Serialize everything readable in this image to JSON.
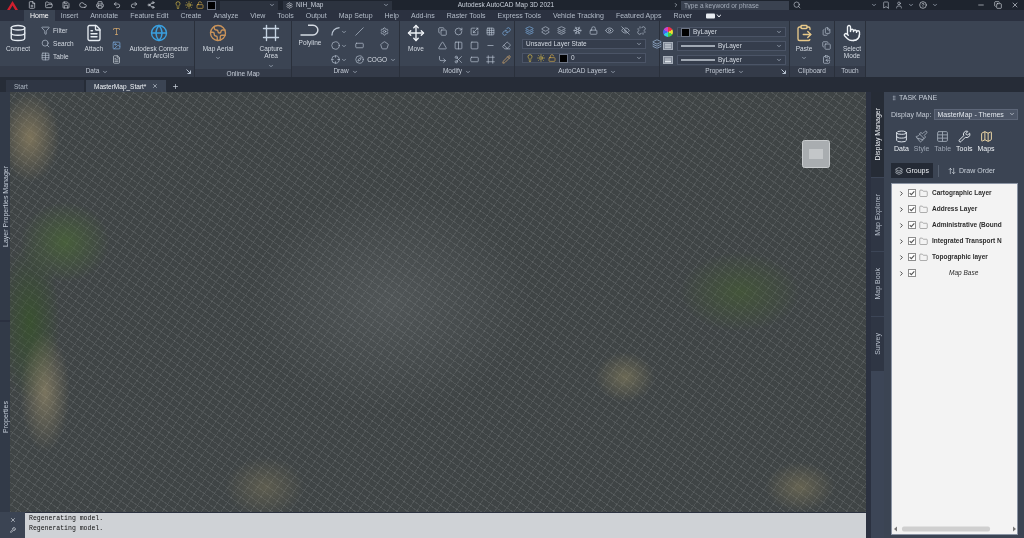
{
  "title_bar": {
    "workspace": "NIH_Map",
    "title": "Autodesk AutoCAD Map 3D 2021",
    "search": {
      "placeholder": "Type a keyword or phrase"
    }
  },
  "ribbon_tabs": [
    {
      "label": "Home",
      "selected": true
    },
    {
      "label": "Insert",
      "selected": false
    },
    {
      "label": "Annotate",
      "selected": false
    },
    {
      "label": "Feature Edit",
      "selected": false
    },
    {
      "label": "Create",
      "selected": false
    },
    {
      "label": "Analyze",
      "selected": false
    },
    {
      "label": "View",
      "selected": false
    },
    {
      "label": "Tools",
      "selected": false
    },
    {
      "label": "Output",
      "selected": false
    },
    {
      "label": "Map Setup",
      "selected": false
    },
    {
      "label": "Help",
      "selected": false
    },
    {
      "label": "Add-ins",
      "selected": false
    },
    {
      "label": "Raster Tools",
      "selected": false
    },
    {
      "label": "Express Tools",
      "selected": false
    },
    {
      "label": "Vehicle Tracking",
      "selected": false
    },
    {
      "label": "Featured Apps",
      "selected": false
    },
    {
      "label": "Rover",
      "selected": false
    }
  ],
  "ribbon_panels": [
    {
      "title": "Data",
      "menu": true,
      "launcher": true,
      "tools": [
        {
          "kind": "large",
          "label": "Connect",
          "dropdown": false
        },
        {
          "kind": "stack",
          "items": [
            "Filter",
            "Search",
            "Table"
          ]
        },
        {
          "kind": "large",
          "label": "Attach",
          "dropdown": false
        },
        {
          "kind": "icons"
        },
        {
          "kind": "large",
          "label": "Autodesk Connector for ArcGIS",
          "dropdown": false
        }
      ]
    },
    {
      "title": "Online Map",
      "menu": false,
      "launcher": false,
      "tools": [
        {
          "kind": "large",
          "label": "Map Aerial",
          "dropdown": true
        },
        {
          "kind": "large",
          "label": "Capture Area",
          "dropdown": true
        }
      ]
    },
    {
      "title": "Draw",
      "menu": true,
      "launcher": false,
      "tools": [
        {
          "kind": "large",
          "label": "Polyline",
          "dropdown": false
        },
        {
          "kind": "draw_grid",
          "label": "COGO"
        }
      ]
    },
    {
      "title": "Modify",
      "menu": true,
      "launcher": false,
      "tools": [
        {
          "kind": "large",
          "label": "Move",
          "dropdown": false
        },
        {
          "kind": "icons"
        }
      ]
    },
    {
      "title": "AutoCAD Layers",
      "menu": true,
      "launcher": false,
      "tools": [
        {
          "kind": "layers",
          "layer_state": "Unsaved Layer State",
          "current_layer": "0"
        }
      ]
    },
    {
      "title": "Properties",
      "menu": true,
      "launcher": true,
      "tools": [
        {
          "kind": "properties",
          "values": [
            "ByLayer",
            "ByLayer",
            "ByLayer"
          ]
        }
      ]
    },
    {
      "title": "Clipboard",
      "menu": false,
      "launcher": false,
      "tools": [
        {
          "kind": "large",
          "label": "Paste",
          "dropdown": true
        },
        {
          "kind": "icons"
        }
      ]
    },
    {
      "title": "Touch",
      "menu": false,
      "launcher": false,
      "tools": [
        {
          "kind": "large",
          "label": "Select Mode",
          "dropdown": false
        }
      ]
    }
  ],
  "file_tabs": [
    {
      "label": "Start",
      "selected": false,
      "closable": false
    },
    {
      "label": "MasterMap_Start*",
      "selected": true,
      "closable": true
    }
  ],
  "left_tabs": [
    "Layer Properties Manager",
    "Properties"
  ],
  "command_line": {
    "history": [
      "Regenerating model.",
      "Regenerating model."
    ]
  },
  "task_pane": {
    "title": "TASK PANE",
    "side_tabs": [
      {
        "label": "Display Manager",
        "selected": true
      },
      {
        "label": "Map Explorer",
        "selected": false
      },
      {
        "label": "Map Book",
        "selected": false
      },
      {
        "label": "Survey",
        "selected": false
      }
    ],
    "display_map": {
      "label": "Display Map:",
      "value": "MasterMap - Themes"
    },
    "tools": [
      {
        "label": "Data",
        "disabled": false
      },
      {
        "label": "Style",
        "disabled": true
      },
      {
        "label": "Table",
        "disabled": true
      },
      {
        "label": "Tools",
        "disabled": false
      },
      {
        "label": "Maps",
        "disabled": false
      }
    ],
    "view_tabs": [
      {
        "label": "Groups",
        "selected": true
      },
      {
        "label": "Draw Order",
        "selected": false
      }
    ],
    "layers": [
      {
        "kind": "group",
        "label": "Cartographic Layer",
        "expanded": false,
        "checked": true
      },
      {
        "kind": "group",
        "label": "Address Layer",
        "expanded": false,
        "checked": true
      },
      {
        "kind": "group",
        "label": "Administrative (Bound",
        "expanded": false,
        "checked": true
      },
      {
        "kind": "group",
        "label": "Integrated Transport N",
        "expanded": false,
        "checked": true
      },
      {
        "kind": "group",
        "label": "Topographic layer",
        "expanded": false,
        "checked": true
      },
      {
        "kind": "base",
        "label": "Map Base",
        "expanded": false,
        "checked": true
      }
    ]
  }
}
